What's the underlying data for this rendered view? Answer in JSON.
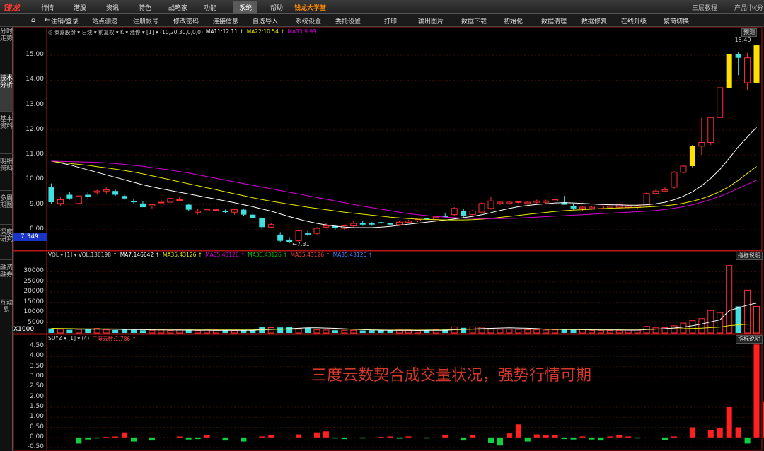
{
  "menubar": {
    "logo": "钱龙",
    "items": [
      "行情",
      "港股",
      "资讯",
      "特色",
      "战略家",
      "功能",
      "系统",
      "帮助",
      "钱龙大学堂"
    ],
    "active": "系统",
    "right_items": [
      "三层教程",
      "产品中心",
      "分"
    ]
  },
  "toolbar": {
    "items": [
      "注销/登录",
      "站点测速",
      "注册帐号",
      "修改密码",
      "连接信息",
      "自选导入",
      "系统设置",
      "委托设置",
      "打印",
      "输出图片",
      "数据下载",
      "初始化",
      "数据清理",
      "数据修复",
      "在线升级",
      "繁简切换"
    ]
  },
  "sidebar": {
    "tabs": [
      "分时走势",
      "技术分析",
      "基本资料",
      "明细资料",
      "多周期图",
      "深度研究",
      "融资融券",
      "互动易"
    ],
    "active": "技术分析"
  },
  "kline_header": {
    "segments": [
      {
        "text": "◎ 泰嘉股份 ▾ 日线 ▾ 前复权 ▾ K ▾ 涨停 ▾ [1] ▾ (10,20,30,0,0,0)",
        "color": "#d0d0d0"
      },
      {
        "text": "MA11:12.11 ↑",
        "color": "#ffffff"
      },
      {
        "text": "MA22:10.54 ↑",
        "color": "#e8e800"
      },
      {
        "text": "MA33:9.99 ↑",
        "color": "#d800d8"
      }
    ],
    "right_btn": "预测"
  },
  "vol_header": {
    "segments": [
      {
        "text": "VOL ▾ [1] ▾ VOL:136198 ↑",
        "color": "#d0d0d0"
      },
      {
        "text": "MA7:146642 ↑",
        "color": "#ffffff"
      },
      {
        "text": "MA35:43126 ↑",
        "color": "#e8e800"
      },
      {
        "text": "MA35:43126 ↑",
        "color": "#d800d8"
      },
      {
        "text": "MA35:43126 ↑",
        "color": "#00c000"
      },
      {
        "text": "MA35:43126 ↑",
        "color": "#ff4040"
      },
      {
        "text": "MA35:43126 ↑",
        "color": "#4080ff"
      }
    ],
    "right_btn": "指标说明",
    "unit": "X1000"
  },
  "sdyz_header": {
    "segments": [
      {
        "text": "SDYZ ▾ [1] ▾ (4)",
        "color": "#d0d0d0"
      },
      {
        "text": "三度云数:1.786 ↑",
        "color": "#ff4040"
      }
    ],
    "right_btn": "指标说明"
  },
  "current_price": "7.349",
  "low_label": "←7.31",
  "high_label": "15.40",
  "annotation": "三度云数契合成交量状况，强势行情可期",
  "colors": {
    "up": "#ff3030",
    "down": "#40e0e0",
    "limit": "#ffe000",
    "ma1": "#ffffff",
    "ma2": "#e8e800",
    "ma3": "#d800d8"
  },
  "chart_data": [
    {
      "type": "candlestick",
      "ylim": [
        7.2,
        15.8
      ],
      "yticks": [
        "15.00",
        "14.00",
        "13.00",
        "12.00",
        "11.00",
        "10.00",
        "9.00",
        "8.00"
      ],
      "ohlc": [
        [
          9.7,
          9.85,
          9.05,
          9.1
        ],
        [
          9.05,
          9.3,
          8.95,
          9.2
        ],
        [
          9.4,
          9.5,
          9.2,
          9.25
        ],
        [
          9.05,
          9.4,
          9.0,
          9.35
        ],
        [
          9.4,
          9.5,
          9.25,
          9.3
        ],
        [
          9.5,
          9.6,
          9.4,
          9.55
        ],
        [
          9.55,
          9.7,
          9.45,
          9.6
        ],
        [
          9.55,
          9.6,
          9.35,
          9.4
        ],
        [
          9.35,
          9.4,
          9.2,
          9.25
        ],
        [
          9.15,
          9.25,
          9.05,
          9.1
        ],
        [
          9.05,
          9.15,
          8.95,
          8.9
        ],
        [
          8.95,
          9.0,
          8.85,
          9.0
        ],
        [
          9.1,
          9.2,
          9.05,
          9.1
        ],
        [
          9.1,
          9.25,
          9.1,
          9.25
        ],
        [
          9.2,
          9.3,
          9.15,
          9.2
        ],
        [
          9.0,
          9.05,
          8.75,
          8.8
        ],
        [
          8.7,
          8.85,
          8.6,
          8.75
        ],
        [
          8.75,
          8.9,
          8.7,
          8.8
        ],
        [
          8.8,
          8.95,
          8.75,
          8.8
        ],
        [
          8.75,
          8.8,
          8.65,
          8.7
        ],
        [
          8.7,
          8.85,
          8.6,
          8.8
        ],
        [
          8.8,
          8.85,
          8.55,
          8.6
        ],
        [
          8.6,
          8.7,
          8.5,
          8.45
        ],
        [
          8.45,
          8.5,
          8.0,
          8.1
        ],
        [
          8.1,
          8.25,
          8.05,
          8.2
        ],
        [
          7.8,
          7.9,
          7.5,
          7.55
        ],
        [
          7.6,
          7.7,
          7.45,
          7.5
        ],
        [
          7.55,
          8.0,
          7.5,
          7.95
        ],
        [
          7.85,
          7.95,
          7.75,
          7.8
        ],
        [
          7.85,
          8.1,
          7.8,
          8.05
        ],
        [
          8.1,
          8.25,
          8.05,
          8.15
        ],
        [
          8.15,
          8.2,
          8.0,
          8.05
        ],
        [
          8.05,
          8.2,
          8.0,
          8.15
        ],
        [
          8.15,
          8.35,
          8.1,
          8.25
        ],
        [
          8.25,
          8.35,
          8.15,
          8.2
        ],
        [
          8.25,
          8.3,
          8.15,
          8.2
        ],
        [
          8.3,
          8.35,
          8.2,
          8.25
        ],
        [
          8.25,
          8.3,
          8.15,
          8.2
        ],
        [
          8.2,
          8.35,
          8.15,
          8.3
        ],
        [
          8.3,
          8.4,
          8.25,
          8.35
        ],
        [
          8.35,
          8.45,
          8.3,
          8.4
        ],
        [
          8.45,
          8.5,
          8.35,
          8.4
        ],
        [
          8.4,
          8.55,
          8.35,
          8.5
        ],
        [
          8.55,
          8.65,
          8.45,
          8.5
        ],
        [
          8.6,
          8.9,
          8.55,
          8.85
        ],
        [
          8.75,
          8.85,
          8.45,
          8.55
        ],
        [
          8.6,
          8.8,
          8.5,
          8.75
        ],
        [
          8.7,
          9.1,
          8.65,
          9.05
        ],
        [
          8.85,
          9.3,
          8.8,
          9.15
        ],
        [
          9.05,
          9.15,
          9.0,
          9.1
        ],
        [
          9.05,
          9.15,
          9.0,
          9.1
        ],
        [
          9.1,
          9.15,
          9.05,
          9.12
        ],
        [
          9.05,
          9.15,
          9.0,
          9.1
        ],
        [
          9.1,
          9.2,
          9.05,
          9.15
        ],
        [
          9.1,
          9.2,
          9.05,
          9.15
        ],
        [
          9.15,
          9.25,
          9.1,
          9.2
        ],
        [
          9.1,
          9.35,
          9.05,
          9.0
        ],
        [
          8.95,
          9.05,
          8.8,
          8.85
        ],
        [
          8.85,
          8.95,
          8.75,
          8.9
        ],
        [
          8.85,
          8.95,
          8.8,
          8.9
        ],
        [
          8.85,
          9.0,
          8.8,
          8.95
        ],
        [
          8.9,
          9.0,
          8.85,
          8.95
        ],
        [
          8.9,
          9.05,
          8.85,
          9.0
        ],
        [
          8.9,
          9.0,
          8.85,
          8.95
        ],
        [
          8.9,
          9.0,
          8.85,
          8.95
        ],
        [
          8.95,
          9.5,
          8.9,
          9.45
        ],
        [
          9.45,
          9.6,
          9.4,
          9.55
        ],
        [
          9.55,
          9.7,
          9.5,
          9.6
        ],
        [
          9.7,
          10.35,
          9.65,
          10.3
        ],
        [
          10.3,
          10.6,
          10.25,
          10.55
        ],
        [
          10.55,
          11.4,
          10.5,
          11.35
        ],
        [
          11.35,
          12.5,
          11.0,
          11.5
        ],
        [
          11.5,
          12.5,
          11.4,
          12.5
        ],
        [
          12.5,
          13.7,
          12.8,
          13.7
        ],
        [
          13.7,
          15.05,
          13.7,
          15.05
        ],
        [
          15.05,
          15.15,
          14.2,
          14.9
        ],
        [
          13.9,
          15.1,
          13.6,
          14.9
        ],
        [
          13.9,
          15.4,
          13.9,
          15.4
        ]
      ],
      "limit_up_indices": [
        70,
        74,
        77
      ],
      "ma": [
        {
          "name": "MA11",
          "values": [
            10.75,
            10.68,
            10.6,
            10.5,
            10.4,
            10.3,
            10.2,
            10.1,
            10.0,
            9.9,
            9.8,
            9.72,
            9.64,
            9.57,
            9.5,
            9.43,
            9.36,
            9.29,
            9.22,
            9.15,
            9.08,
            9.0,
            8.92,
            8.83,
            8.74,
            8.63,
            8.52,
            8.42,
            8.33,
            8.25,
            8.19,
            8.14,
            8.1,
            8.08,
            8.08,
            8.08,
            8.1,
            8.13,
            8.17,
            8.22,
            8.26,
            8.3,
            8.34,
            8.38,
            8.43,
            8.48,
            8.53,
            8.6,
            8.68,
            8.77,
            8.85,
            8.92,
            8.97,
            9.01,
            9.04,
            9.07,
            9.08,
            9.07,
            9.05,
            9.03,
            9.01,
            9.0,
            8.99,
            8.98,
            8.98,
            9.0,
            9.04,
            9.1,
            9.2,
            9.34,
            9.52,
            9.76,
            10.06,
            10.42,
            10.86,
            11.32,
            11.72,
            12.11
          ]
        },
        {
          "name": "MA22",
          "values": [
            10.75,
            10.7,
            10.66,
            10.62,
            10.58,
            10.53,
            10.48,
            10.43,
            10.37,
            10.31,
            10.24,
            10.16,
            10.08,
            10.0,
            9.92,
            9.84,
            9.76,
            9.68,
            9.6,
            9.52,
            9.44,
            9.36,
            9.28,
            9.21,
            9.14,
            9.08,
            9.02,
            8.96,
            8.9,
            8.85,
            8.8,
            8.75,
            8.7,
            8.66,
            8.62,
            8.58,
            8.54,
            8.5,
            8.47,
            8.44,
            8.42,
            8.41,
            8.4,
            8.39,
            8.39,
            8.39,
            8.4,
            8.42,
            8.45,
            8.49,
            8.53,
            8.57,
            8.61,
            8.65,
            8.69,
            8.73,
            8.76,
            8.78,
            8.8,
            8.82,
            8.84,
            8.86,
            8.87,
            8.88,
            8.89,
            8.91,
            8.93,
            8.96,
            9.0,
            9.06,
            9.14,
            9.24,
            9.37,
            9.53,
            9.73,
            9.98,
            10.26,
            10.54
          ]
        },
        {
          "name": "MA33",
          "values": [
            10.75,
            10.74,
            10.73,
            10.72,
            10.71,
            10.7,
            10.68,
            10.65,
            10.62,
            10.58,
            10.54,
            10.49,
            10.44,
            10.39,
            10.33,
            10.27,
            10.2,
            10.13,
            10.06,
            9.99,
            9.92,
            9.85,
            9.78,
            9.71,
            9.64,
            9.57,
            9.5,
            9.43,
            9.36,
            9.29,
            9.22,
            9.15,
            9.08,
            9.01,
            8.94,
            8.88,
            8.82,
            8.76,
            8.7,
            8.64,
            8.6,
            8.56,
            8.53,
            8.5,
            8.48,
            8.46,
            8.45,
            8.44,
            8.44,
            8.44,
            8.45,
            8.46,
            8.48,
            8.5,
            8.52,
            8.54,
            8.56,
            8.58,
            8.6,
            8.62,
            8.64,
            8.66,
            8.68,
            8.7,
            8.72,
            8.74,
            8.77,
            8.81,
            8.86,
            8.92,
            9.0,
            9.1,
            9.21,
            9.34,
            9.49,
            9.65,
            9.82,
            9.99
          ]
        }
      ]
    },
    {
      "type": "bar",
      "title": "VOL",
      "ylim": [
        0,
        36000
      ],
      "yticks": [
        "30000",
        "25000",
        "20000",
        "15000",
        "10000",
        "5000"
      ],
      "values": [
        2200,
        1800,
        1500,
        1800,
        2000,
        2200,
        1500,
        1400,
        1600,
        1500,
        1300,
        1300,
        1400,
        1200,
        1500,
        1300,
        1200,
        1400,
        1300,
        1300,
        1200,
        1300,
        1400,
        2800,
        2600,
        2700,
        2800,
        2200,
        2600,
        1500,
        1400,
        1300,
        1300,
        1300,
        1200,
        1300,
        1300,
        1200,
        1300,
        1300,
        1200,
        1300,
        1400,
        1600,
        3000,
        2500,
        3000,
        2800,
        2200,
        1800,
        1800,
        1700,
        1500,
        1500,
        1400,
        1500,
        2000,
        1800,
        1600,
        1300,
        1300,
        1200,
        1300,
        1400,
        1400,
        3200,
        2500,
        2600,
        3500,
        4800,
        6000,
        7000,
        11000,
        10000,
        33000,
        13000,
        21000,
        13000
      ],
      "ma": [
        {
          "name": "MA7",
          "values": [
            2200,
            2100,
            1900,
            1850,
            1850,
            1850,
            1800,
            1750,
            1680,
            1640,
            1580,
            1520,
            1470,
            1430,
            1400,
            1380,
            1350,
            1340,
            1320,
            1310,
            1300,
            1300,
            1310,
            1550,
            1700,
            1860,
            2050,
            2280,
            2480,
            2510,
            2400,
            2240,
            2030,
            1850,
            1580,
            1440,
            1340,
            1300,
            1290,
            1270,
            1260,
            1270,
            1280,
            1330,
            1570,
            1710,
            1920,
            2110,
            2260,
            2400,
            2480,
            2400,
            2270,
            2100,
            1850,
            1720,
            1640,
            1610,
            1590,
            1530,
            1500,
            1460,
            1440,
            1400,
            1380,
            1660,
            1870,
            2120,
            2410,
            2890,
            3540,
            4370,
            5440,
            6400,
            10900,
            12300,
            13600,
            14664
          ]
        },
        {
          "name": "MA35",
          "values": [
            2200,
            2150,
            2100,
            2050,
            2020,
            2000,
            1980,
            1950,
            1920,
            1900,
            1880,
            1860,
            1840,
            1820,
            1800,
            1780,
            1760,
            1750,
            1740,
            1730,
            1720,
            1720,
            1720,
            1760,
            1790,
            1820,
            1850,
            1880,
            1900,
            1900,
            1890,
            1880,
            1860,
            1840,
            1820,
            1810,
            1800,
            1790,
            1780,
            1770,
            1760,
            1750,
            1750,
            1750,
            1780,
            1800,
            1830,
            1860,
            1880,
            1890,
            1890,
            1890,
            1880,
            1870,
            1860,
            1850,
            1850,
            1850,
            1840,
            1830,
            1820,
            1810,
            1800,
            1800,
            1800,
            1840,
            1880,
            1920,
            1980,
            2080,
            2200,
            2360,
            2620,
            2880,
            3600,
            3920,
            4300,
            4313
          ]
        }
      ]
    },
    {
      "type": "bar",
      "title": "SDYZ",
      "ylim": [
        -0.6,
        4.75
      ],
      "yticks": [
        "4.50",
        "4.00",
        "3.50",
        "3.00",
        "2.50",
        "2.00",
        "1.50",
        "1.00",
        "0.50",
        "0.00",
        "-0.50"
      ],
      "values": [
        0,
        0,
        0,
        -0.3,
        -0.1,
        -0.05,
        0.02,
        0.05,
        0.25,
        -0.2,
        0.0,
        -0.15,
        0.0,
        0.0,
        0.05,
        -0.1,
        -0.08,
        0.1,
        0.0,
        -0.15,
        0.0,
        -0.2,
        0.0,
        0.05,
        0.1,
        0.0,
        0.0,
        0.15,
        0.0,
        0.25,
        0.3,
        -0.05,
        -0.08,
        0.0,
        -0.05,
        0.0,
        0.02,
        0.05,
        -0.06,
        0.05,
        0.0,
        -0.05,
        0.0,
        0.1,
        0.0,
        -0.15,
        0.1,
        0.0,
        -0.25,
        -0.4,
        0.2,
        0.65,
        -0.2,
        0.15,
        0.1,
        0.1,
        -0.08,
        -0.1,
        0.05,
        -0.1,
        -0.15,
        0.05,
        0.1,
        0.05,
        -0.05,
        0.0,
        0.0,
        -0.12,
        0.05,
        0.0,
        0.5,
        0.0,
        0.35,
        0.45,
        1.5,
        0.5,
        -0.3,
        4.6,
        1.786
      ],
      "color_note": "red for positive, green for negative"
    }
  ]
}
